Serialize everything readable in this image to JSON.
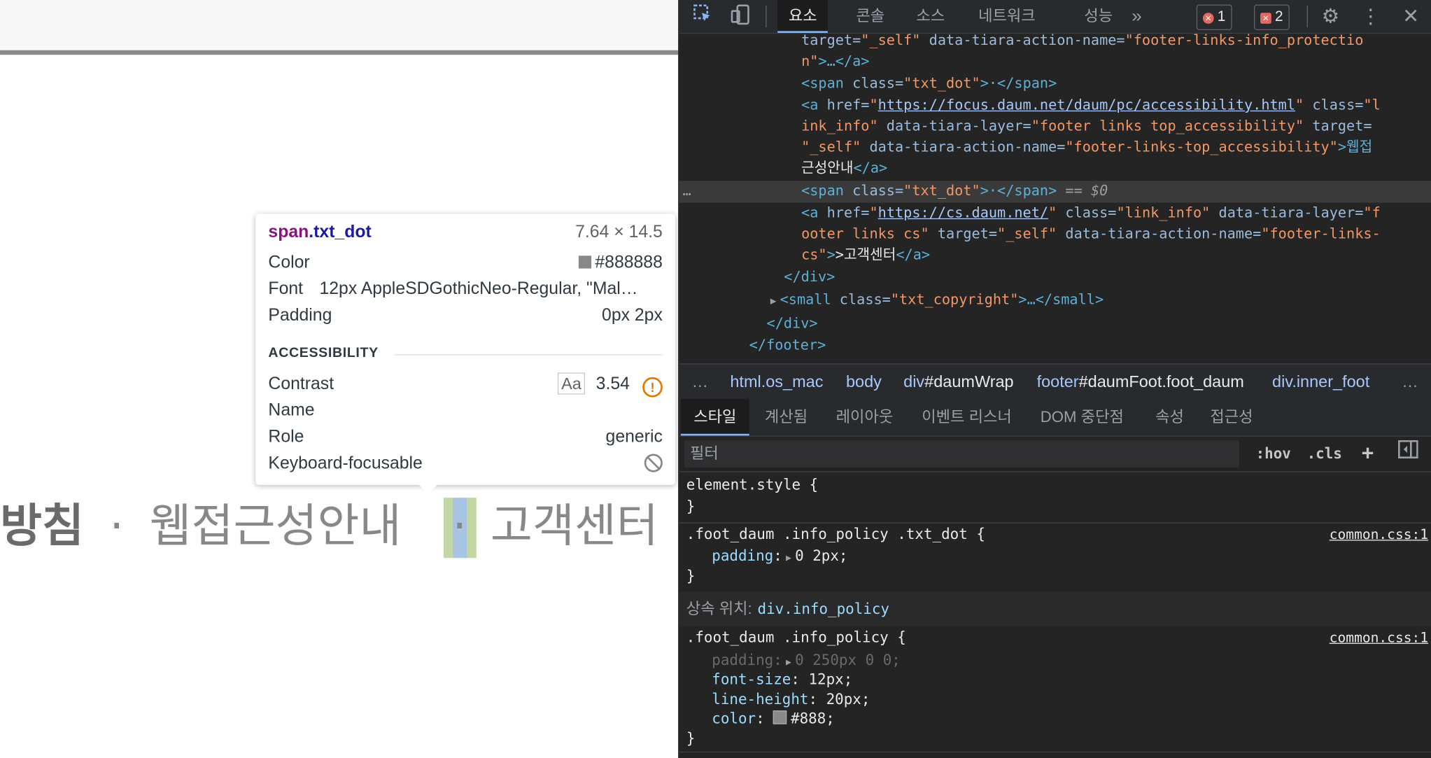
{
  "page": {
    "footer_links": {
      "policy_tail": "방침",
      "dot1": "·",
      "accessibility": "웹접근성안내",
      "dot2": "·",
      "cs": "고객센터"
    }
  },
  "tooltip": {
    "tag": "span",
    "cls": ".txt_dot",
    "size": "7.64 × 14.5",
    "color_label": "Color",
    "color_value": "#888888",
    "font_label": "Font",
    "font_value": "12px AppleSDGothicNeo-Regular, \"Mal…",
    "padding_label": "Padding",
    "padding_value": "0px 2px",
    "section": "ACCESSIBILITY",
    "contrast_label": "Contrast",
    "contrast_aa": "Aa",
    "contrast_value": "3.54",
    "name_label": "Name",
    "role_label": "Role",
    "role_value": "generic",
    "kb_label": "Keyboard-focusable"
  },
  "devtools": {
    "tabs": [
      "요소",
      "콘솔",
      "소스",
      "네트워크",
      "성능"
    ],
    "more_tabs": "»",
    "badge_errors": "1",
    "badge_issues": "2",
    "code": {
      "l1": {
        "a": "target=",
        "v": "\"_self\"",
        "a2": " data-tiara-action-name=",
        "v2": "\"footer-links-info_protectio"
      },
      "l2": {
        "v": "n\"",
        "t": ">…</a>"
      },
      "l3": {
        "t1": "<span ",
        "a": "class=",
        "v": "\"txt_dot\"",
        "t2": ">·</span>"
      },
      "l4": {
        "t1": "<a ",
        "a": "href=",
        "v": "\"",
        "link": "https://focus.daum.net/daum/pc/accessibility.html",
        "v2": "\"",
        "a2": " class=",
        "v3": "\"l"
      },
      "l5": {
        "v": "ink_info\"",
        "a": " data-tiara-layer=",
        "v2": "\"footer links top_accessibility\"",
        "a2": " target="
      },
      "l6": {
        "v": "\"_self\"",
        "a": " data-tiara-action-name=",
        "v2": "\"footer-links-top_accessibility\"",
        "t": ">웹접"
      },
      "l7": {
        "t": "근성안내",
        "t2": "</a>"
      },
      "l8": {
        "t1": "<span ",
        "a": "class=",
        "v": "\"txt_dot\"",
        "t2": ">·</span>",
        "eq": " == $0",
        "ellipsis": "…"
      },
      "l9": {
        "t1": "<a ",
        "a": "href=",
        "v": "\"",
        "link": "https://cs.daum.net/",
        "v2": "\"",
        "a2": " class=",
        "v3": "\"link_info\"",
        "a3": " data-tiara-layer=",
        "v4": "\"f"
      },
      "l10": {
        "v": "ooter links cs\"",
        "a": " target=",
        "v2": "\"_self\"",
        "a2": " data-tiara-action-name=",
        "v3": "\"footer-links-"
      },
      "l11": {
        "v": "cs\"",
        "t": ">고객센터",
        "t2": "</a>"
      },
      "l12": {
        "t": "</div>"
      },
      "l13": {
        "t1": "<small ",
        "a": "class=",
        "v": "\"txt_copyright\"",
        "t2": ">…</small>"
      },
      "l14": {
        "t": "</div>"
      },
      "l15": {
        "t": "</footer>"
      }
    },
    "crumbs": {
      "ellipsis_left": "…",
      "c1": "html.os_mac",
      "c2": "body",
      "c3a": "div",
      "c3b": "#daumWrap",
      "c4a": "footer",
      "c4b": "#daumFoot.foot_daum",
      "c5": "div.inner_foot",
      "ellipsis_right": "…"
    },
    "style_tabs": [
      "스타일",
      "계산됨",
      "레이아웃",
      "이벤트 리스너",
      "DOM 중단점",
      "속성",
      "접근성"
    ],
    "filter_placeholder": "필터",
    "hov": ":hov",
    "cls": ".cls",
    "plus": "+",
    "rules": {
      "element_style": "element.style {",
      "close": "}",
      "r1_sel": ".foot_daum .info_policy .txt_dot {",
      "r1_src": "common.css:1",
      "r1_prop": "padding",
      "r1_val": "0 2px;",
      "inherit_label": "상속 위치:",
      "inherit_cls": "div.info_policy",
      "r2_sel": ".foot_daum .info_policy {",
      "r2_src": "common.css:1",
      "r2_p1": "padding",
      "r2_v1": "0 250px 0 0;",
      "r2_p2": "font-size",
      "r2_v2": "12px;",
      "r2_p3": "line-height",
      "r2_v3": "20px;",
      "r2_p4": "color",
      "r2_v4": "#888;"
    }
  },
  "colors": {
    "text_dot": "#888888",
    "devtools_bg": "#242424",
    "accent": "#8ab4f8"
  }
}
